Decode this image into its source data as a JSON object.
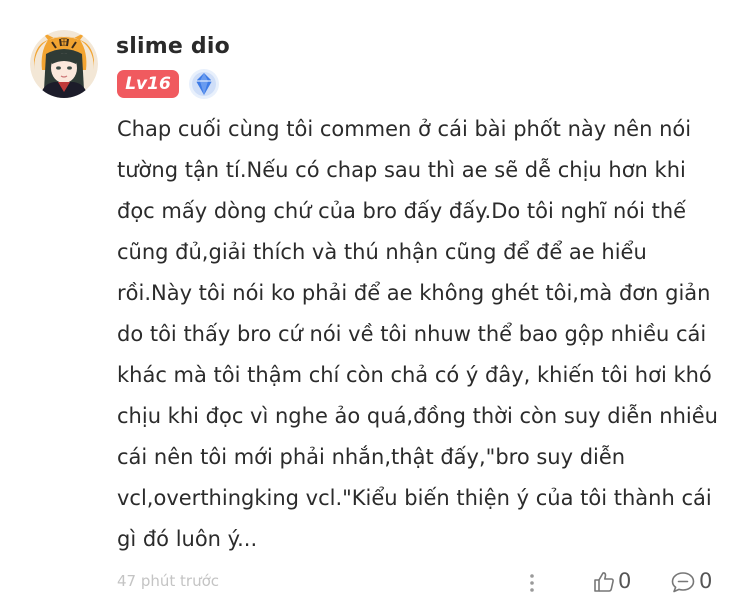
{
  "comment": {
    "username": "slime dio",
    "level_badge": "Lv16",
    "rank_badge_icon": "blue-diamond-rank-icon",
    "avatar_icon": "tiger-hood-anime-avatar",
    "body_lines": [
      "Chap cuối cùng tôi commen ở cái bài phốt này nên nói",
      "tường tận tí.Nếu có chap sau thì ae sẽ dễ chịu hơn khi",
      "đọc mấy dòng chứ của bro đấy đấy.Do tôi nghĩ nói thế",
      "cũng đủ,giải thích và thú nhận cũng để để ae hiểu",
      "rồi.Này tôi nói ko phải để ae không ghét tôi,mà đơn giản",
      "do tôi thấy bro cứ nói về tôi nhuw thể bao gộp nhiều cái",
      "khác mà tôi thậm chí còn chả có ý đây, khiến tôi hơi khó",
      "chịu khi đọc vì nghe ảo quá,đồng thời còn suy diễn nhiều",
      "cái nên tôi mới phải nhắn,thật đấy,\"bro suy diễn",
      "vcl,overthingking vcl.\"Kiểu biến thiện ý của tôi thành cái",
      "gì đó luôn ý..."
    ],
    "timestamp": "47 phút trước",
    "like_count": "0",
    "reply_count": "0"
  },
  "colors": {
    "level_badge_bg": "#f05a5f",
    "rank_badge_blue": "#3d7be6",
    "muted_text": "#c4c4c4"
  }
}
